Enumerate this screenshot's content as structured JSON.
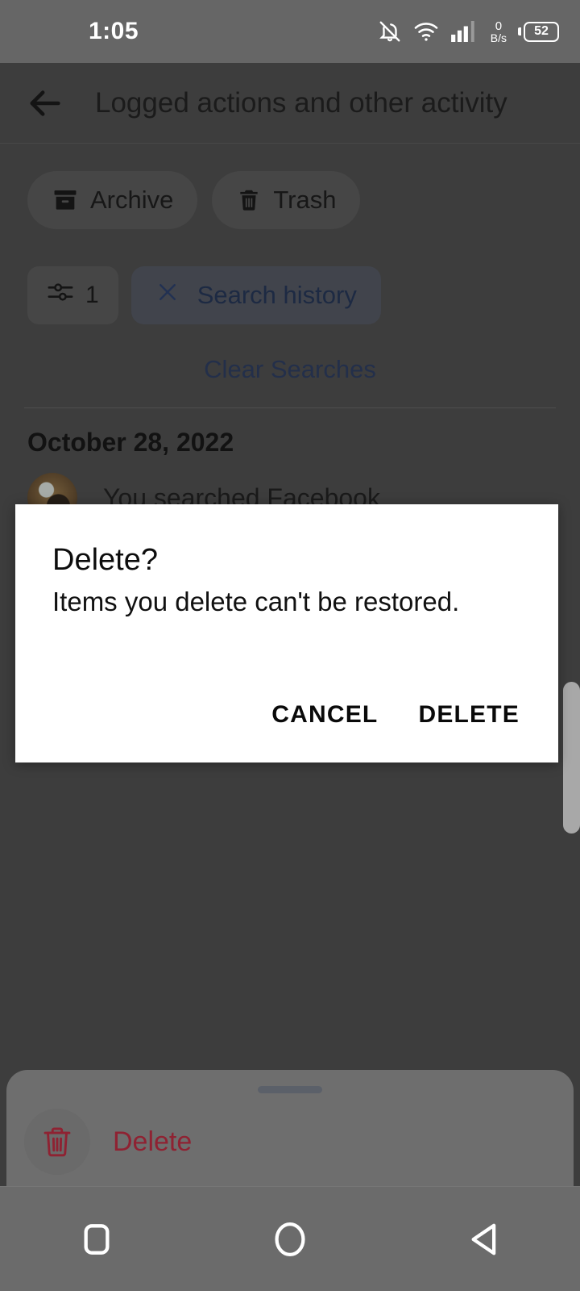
{
  "status_bar": {
    "time": "1:05",
    "icons": [
      "notifications-off-icon",
      "wifi-icon",
      "cellular-signal-icon"
    ],
    "net_speed_value": "0",
    "net_speed_unit": "B/s",
    "battery_level": "52"
  },
  "app_bar": {
    "back_icon": "back-arrow-icon",
    "title": "Logged actions and other activity"
  },
  "chips": [
    {
      "label": "Archive",
      "icon": "archive-icon"
    },
    {
      "label": "Trash",
      "icon": "trash-icon"
    }
  ],
  "filters": {
    "filter_icon": "tune-filter-icon",
    "filter_count": "1",
    "active_filter_label": "Search history",
    "active_filter_close_icon": "close-x-icon"
  },
  "clear_searches_label": "Clear Searches",
  "feed": {
    "date_header": "October 28, 2022",
    "items": [
      {
        "avatar": "user-avatar",
        "text": "You searched Facebook"
      }
    ]
  },
  "dialog": {
    "title": "Delete?",
    "message": "Items you delete can't be restored.",
    "cancel_label": "CANCEL",
    "confirm_label": "DELETE"
  },
  "bottom_sheet": {
    "handle": "drag-handle",
    "action_label": "Delete",
    "action_icon": "trash-icon",
    "action_color": "#8f2232"
  },
  "nav_bar": {
    "recents_icon": "recents-square-icon",
    "home_icon": "home-circle-icon",
    "back_icon": "back-triangle-icon"
  },
  "colors": {
    "status_bar_bg": "#666666",
    "app_bg": "#3d3d3d",
    "dialog_bg": "#ffffff",
    "link_blue": "#232f4a",
    "danger_red": "#8f2232",
    "nav_bg": "#6b6b6b"
  }
}
